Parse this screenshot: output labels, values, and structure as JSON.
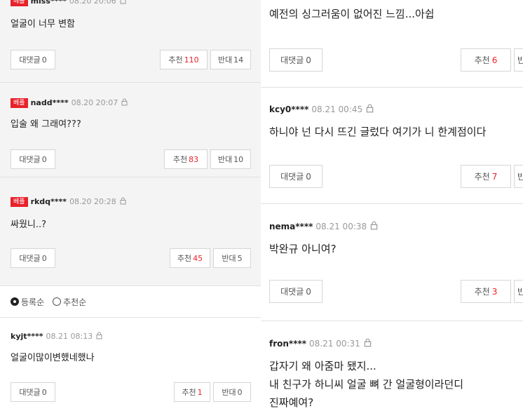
{
  "common": {
    "reply_label": "대댓글",
    "reply_count": "0",
    "up_label": "추천",
    "down_label": "반대",
    "badge_label": "베플"
  },
  "left_comments": [
    {
      "badge": "베플",
      "nick": "miss****",
      "time": "08.20 20:06",
      "text": "얼굴이 너무 변함",
      "up": "110",
      "down": "14"
    },
    {
      "badge": "베플",
      "nick": "nadd****",
      "time": "08.20 20:07",
      "text": "입술 왜 그래여???",
      "up": "83",
      "down": "10"
    },
    {
      "badge": "베플",
      "nick": "rkdq****",
      "time": "08.20 20:28",
      "text": "싸웠니..?",
      "up": "45",
      "down": "5"
    }
  ],
  "sort": {
    "option1": "등록순",
    "option2": "추천순",
    "selected": "등록순"
  },
  "left_bottom_comment": {
    "nick": "kyjt****",
    "time": "08.21 08:13",
    "text": "얼굴이많이변했네했나",
    "up": "1",
    "down": "0"
  },
  "right_comments": [
    {
      "text": "예전의 싱그러움이 없어진 느낌...아쉽",
      "up": "6",
      "down_partial": "반"
    },
    {
      "nick": "kcy0****",
      "time": "08.21 00:45",
      "text": "하니야 넌 다시 뜨긴 글렀다 여기가 니 한계점이다",
      "up": "7",
      "down_partial": "반"
    },
    {
      "nick": "nema****",
      "time": "08.21 00:38",
      "text": "박완규 아니여?",
      "up": "3",
      "down_partial": "반"
    },
    {
      "nick": "fron****",
      "time": "08.21 00:31",
      "lines": [
        "갑자기 왜 아줌마 됐지...",
        "내 친구가 하니씨 얼굴 뼈 간 얼굴형이라던디",
        "진짜예여?"
      ]
    }
  ],
  "colors": {
    "accent_red": "#e8222b",
    "panel_gray": "#f4f4f4",
    "border": "#e1e1e1"
  }
}
